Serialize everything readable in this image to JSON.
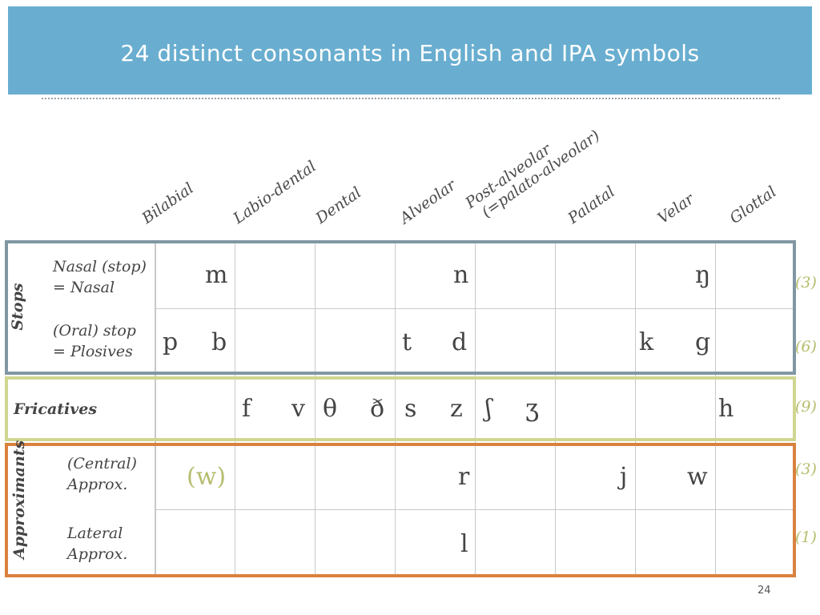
{
  "slide": {
    "title": "24 distinct consonants in English and IPA symbols",
    "page_number": "24"
  },
  "columns": [
    {
      "label": "Bilabial"
    },
    {
      "label": "Labio-dental"
    },
    {
      "label": "Dental"
    },
    {
      "label": "Alveolar"
    },
    {
      "label_line1": "Post-alveolar",
      "label_line2": "(=palato-alveolar)"
    },
    {
      "label": "Palatal"
    },
    {
      "label": "Velar"
    },
    {
      "label": "Glottal"
    }
  ],
  "groups": {
    "stops": "Stops",
    "fricatives": "Fricatives",
    "approximants": "Approximants"
  },
  "rows": {
    "nasal": {
      "line1": "Nasal (stop)",
      "line2": "= Nasal",
      "count": "(3)",
      "symbols": {
        "bilabial": "m",
        "alveolar": "n",
        "velar": "ŋ"
      }
    },
    "plosive": {
      "line1": "(Oral) stop",
      "line2": "= Plosives",
      "count": "(6)",
      "symbols": {
        "p": "p",
        "b": "b",
        "t": "t",
        "d": "d",
        "k": "k",
        "g": "g"
      }
    },
    "fricative": {
      "count": "(9)",
      "symbols": {
        "f": "f",
        "v": "v",
        "th_voiceless": "θ",
        "th_voiced": "ð",
        "s": "s",
        "z": "z",
        "sh": "ʃ",
        "zh": "ʒ",
        "h": "h"
      }
    },
    "central": {
      "line1": "(Central)",
      "line2": "Approx.",
      "count": "(3)",
      "symbols": {
        "w_paren": "(w)",
        "r": "r",
        "j": "j",
        "w": "w"
      }
    },
    "lateral": {
      "line1": "Lateral",
      "line2": "Approx.",
      "count": "(1)",
      "symbols": {
        "l": "l"
      }
    }
  },
  "colors": {
    "title_bg": "#69aed0",
    "stops_border": "#8197a3",
    "fricatives_border": "#d0d690",
    "approximants_border": "#d9823f",
    "count_text": "#b6bd6e"
  }
}
